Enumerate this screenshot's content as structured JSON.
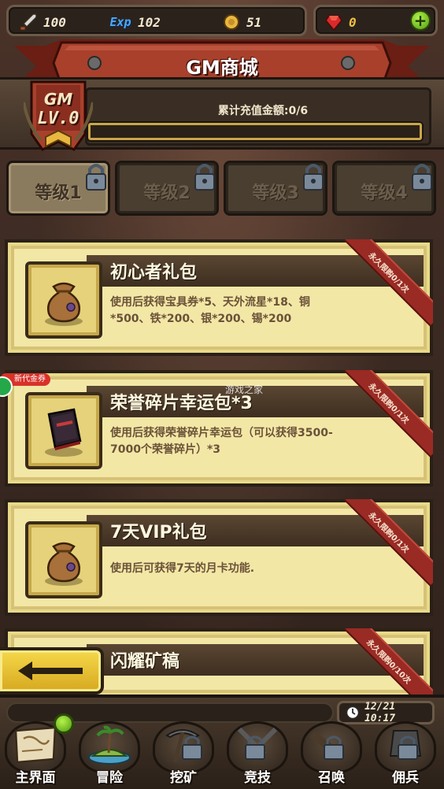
{
  "resources": {
    "attack": "100",
    "exp": "102",
    "exp_icon_text": "Exp",
    "coins": "51",
    "gems": "0"
  },
  "banner": {
    "title": "GM商城"
  },
  "vip": {
    "badge_gm": "GM",
    "badge_level": "LV.0",
    "recharge_label": "累计充值金额:0/6",
    "progress": 0
  },
  "tabs": [
    {
      "label": "等级1",
      "active": true,
      "locked": true
    },
    {
      "label": "等级2",
      "active": false,
      "locked": true
    },
    {
      "label": "等级3",
      "active": false,
      "locked": true
    },
    {
      "label": "等级4",
      "active": false,
      "locked": true
    }
  ],
  "items": [
    {
      "title": "初心者礼包",
      "desc": "使用后获得宝具券*5、天外流星*18、铜*500、铁*200、银*200、锡*200",
      "ribbon": "永久限购0/1次",
      "icon": "coin-bag-icon"
    },
    {
      "title": "荣誉碎片幸运包*3",
      "desc": "使用后获得荣誉碎片幸运包（可以获得3500-7000个荣誉碎片）*3",
      "ribbon": "永久限购0/1次",
      "icon": "red-book-icon"
    },
    {
      "title": "7天VIP礼包",
      "desc": "使用后可获得7天的月卡功能.",
      "ribbon": "永久限购0/1次",
      "icon": "coin-bag-icon"
    },
    {
      "title": "闪耀矿稿",
      "desc": "",
      "ribbon": "永久限购0/10次",
      "icon": ""
    }
  ],
  "watermark": {
    "coupon": "新代金券",
    "site": "游戏之家"
  },
  "clock": {
    "time": "12/21 10:17"
  },
  "nav": [
    {
      "label": "主界面",
      "icon": "map-scroll-icon"
    },
    {
      "label": "冒险",
      "icon": "island-icon"
    },
    {
      "label": "挖矿",
      "icon": "pickaxe-lock-icon"
    },
    {
      "label": "竞技",
      "icon": "crossed-swords-lock-icon"
    },
    {
      "label": "召唤",
      "icon": "summon-lock-icon"
    },
    {
      "label": "佣兵",
      "icon": "mercenary-lock-icon"
    }
  ],
  "colors": {
    "card_bg": "#f3e7a6",
    "ribbon": "#9a2a24",
    "banner": "#a8402c",
    "progress_border": "#c9a64a"
  }
}
